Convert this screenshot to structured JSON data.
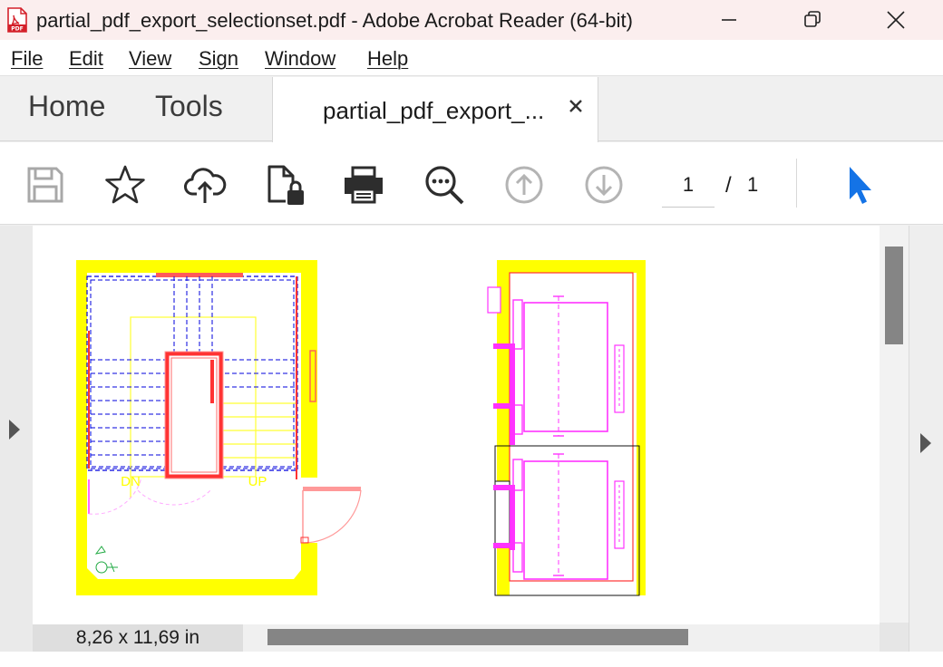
{
  "window": {
    "title": "partial_pdf_export_selectionset.pdf - Adobe Acrobat Reader (64-bit)",
    "app_icon": "pdf-file-icon",
    "accent": "#d4202a"
  },
  "menu": {
    "items": [
      "File",
      "Edit",
      "View",
      "Sign",
      "Window",
      "Help"
    ]
  },
  "tabs": {
    "home": "Home",
    "tools": "Tools",
    "document": "partial_pdf_export_..."
  },
  "toolbar": {
    "icons": [
      "save-icon",
      "star-icon",
      "cloud-upload-icon",
      "file-lock-icon",
      "printer-icon",
      "zoom-search-icon",
      "arrow-up-circle-icon",
      "arrow-down-circle-icon",
      "pointer-cursor-icon"
    ],
    "page_current": "1",
    "page_separator": "/",
    "page_total": "1",
    "cursor_color": "#1473e6"
  },
  "document": {
    "labels": {
      "down": "DN",
      "up": "UP"
    },
    "colors": {
      "wall": "#ffff00",
      "stair_lines": "#0000dd",
      "frame": "#ff3333",
      "elevator": "#ff33ff"
    }
  },
  "status": {
    "page_size": "8,26 x 11,69 in"
  }
}
